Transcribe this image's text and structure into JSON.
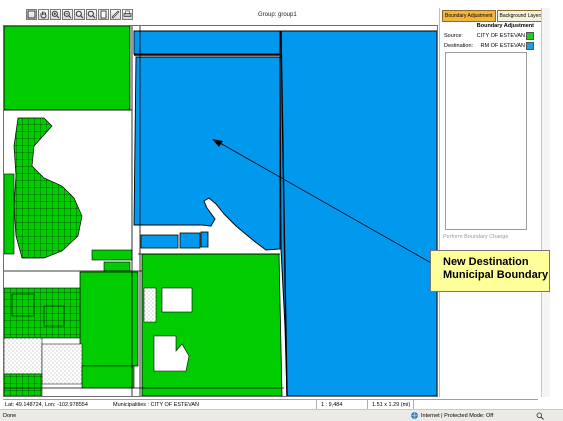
{
  "toolbar": {
    "tools": [
      {
        "name": "zoom-extent-tool-button",
        "icon": "extent-icon"
      },
      {
        "name": "pan-tool-button",
        "icon": "hand-icon"
      },
      {
        "name": "zoom-in-tool-button",
        "icon": "zoom-in-icon"
      },
      {
        "name": "zoom-out-tool-button",
        "icon": "zoom-out-icon"
      },
      {
        "name": "zoom-box-tool-button",
        "icon": "magnifier-icon"
      },
      {
        "name": "zoom-previous-tool-button",
        "icon": "magnifier-icon"
      },
      {
        "name": "select-tool-button",
        "icon": "page-icon"
      },
      {
        "name": "measure-tool-button",
        "icon": "ruler-icon"
      },
      {
        "name": "print-tool-button",
        "icon": "print-icon"
      }
    ],
    "group_label": "Group: group1"
  },
  "panel": {
    "tabs": [
      {
        "label": "Boundary Adjustment",
        "active": true
      },
      {
        "label": "Background Layers",
        "active": false
      }
    ],
    "title": "Boundary Adjustment",
    "source_label": "Source:",
    "source_value": "CITY OF ESTEVAN",
    "source_color": "#22cc22",
    "destination_label": "Destination:",
    "destination_value": "RM OF ESTEVAN",
    "destination_color": "#1aa0e8",
    "perform_button": "Perform Boundary Change"
  },
  "map": {
    "city_color": "#00cc00",
    "rm_color": "#0099ee",
    "outline_color": "#000000"
  },
  "callout": {
    "line1": "New Destination",
    "line2": "Municipal Boundary",
    "background": "#ffff9a"
  },
  "status": {
    "latlon": "Lat: 49.148724, Lon: -102.978554",
    "municipality": "Municipalities : CITY OF ESTEVAN",
    "scale": "1 : 9,484",
    "extent": "1.51 x 1.29 (mi)"
  },
  "browser_status": {
    "left": "Done",
    "zone": "Internet | Protected Mode: Off"
  }
}
